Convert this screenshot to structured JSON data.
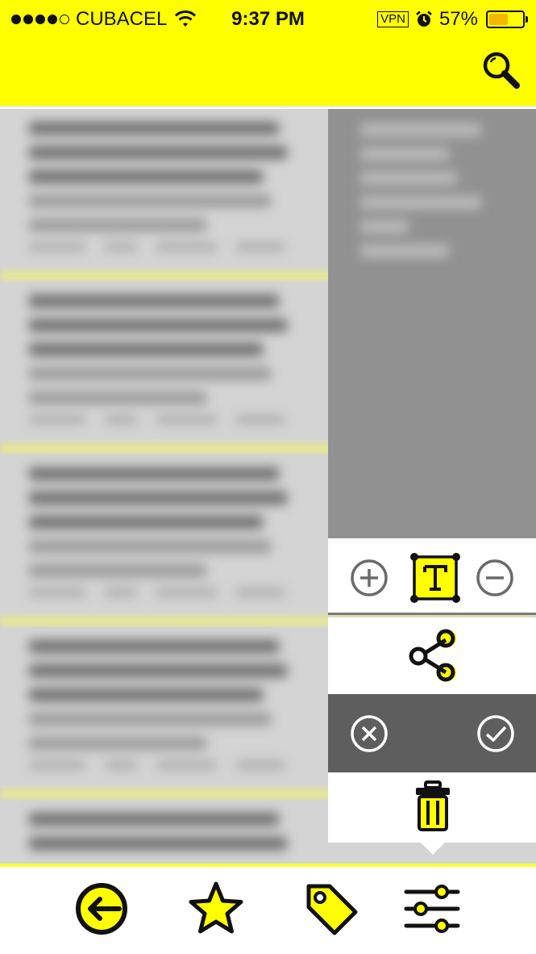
{
  "status_bar": {
    "carrier": "CUBACEL",
    "time": "9:37 PM",
    "vpn": "VPN",
    "battery_percent": "57%",
    "battery_level": 0.57
  },
  "header": {
    "search_icon": "search-icon",
    "background_color": "#ffff00"
  },
  "popup_menu": {
    "font_size_row": [
      "plus-circle-icon",
      "text-format-icon",
      "minus-circle-icon"
    ],
    "share_icon": "share-icon",
    "confirm_row": [
      "cancel-circle-icon",
      "check-circle-icon"
    ],
    "delete_icon": "trash-icon"
  },
  "tab_bar": {
    "tabs": [
      "back-arrow-icon",
      "star-icon",
      "tag-icon",
      "settings-sliders-icon"
    ],
    "accent_color": "#ffff00"
  }
}
